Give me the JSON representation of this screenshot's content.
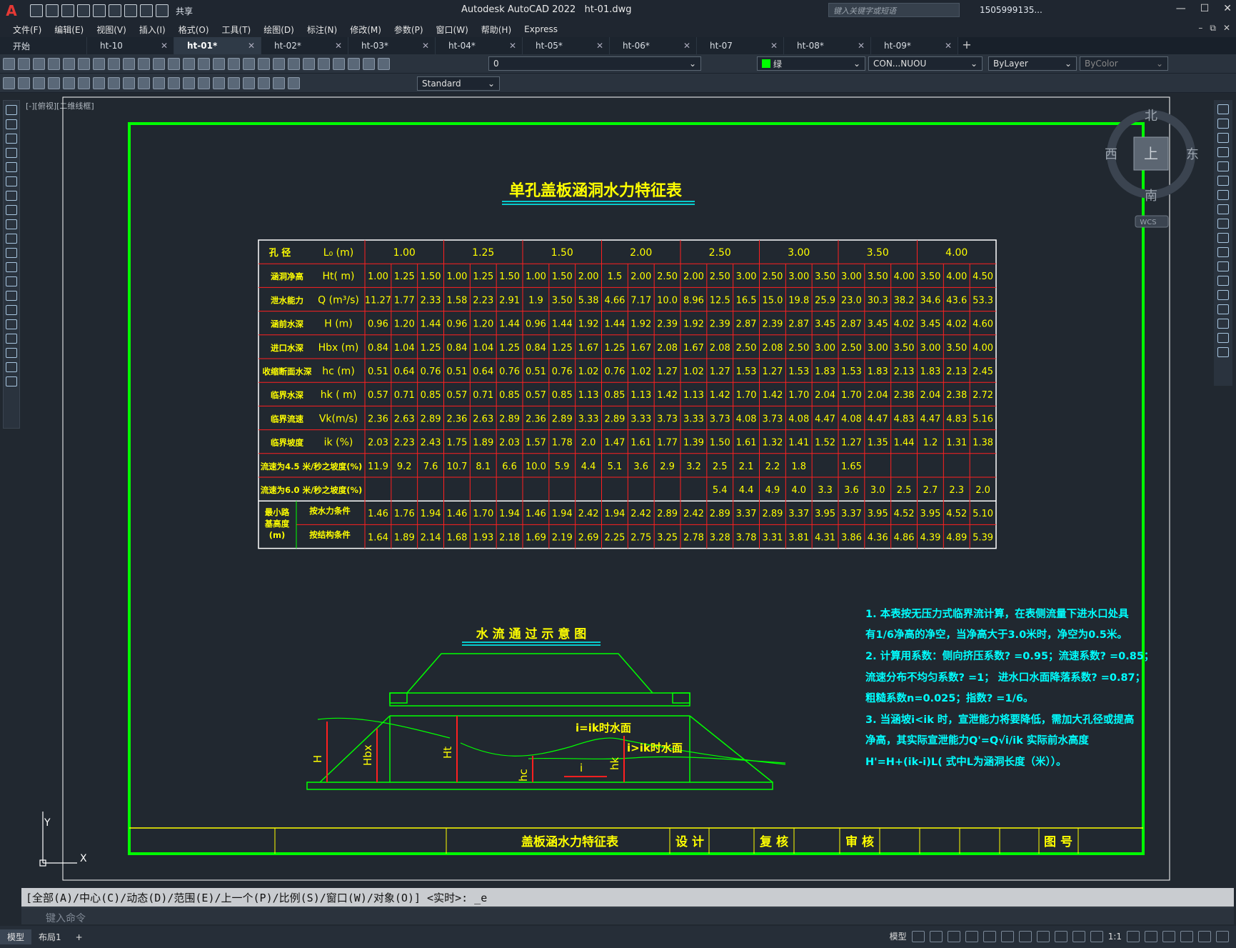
{
  "app": {
    "logo": "A",
    "share": "共享",
    "title": "Autodesk AutoCAD 2022",
    "file": "ht-01.dwg",
    "search_placeholder": "键入关键字或短语",
    "user": "1505999135...",
    "help": "?"
  },
  "menu": [
    "文件(F)",
    "编辑(E)",
    "视图(V)",
    "插入(I)",
    "格式(O)",
    "工具(T)",
    "绘图(D)",
    "标注(N)",
    "修改(M)",
    "参数(P)",
    "窗口(W)",
    "帮助(H)",
    "Express"
  ],
  "tabs": [
    {
      "label": "开始"
    },
    {
      "label": "ht-10"
    },
    {
      "label": "ht-01*",
      "active": true
    },
    {
      "label": "ht-02*"
    },
    {
      "label": "ht-03*"
    },
    {
      "label": "ht-04*"
    },
    {
      "label": "ht-05*"
    },
    {
      "label": "ht-06*"
    },
    {
      "label": "ht-07"
    },
    {
      "label": "ht-08*"
    },
    {
      "label": "ht-09*"
    }
  ],
  "toolbar": {
    "layer": "0",
    "color": "绿",
    "linetype": "CON...NUOU",
    "lineweight": "ByLayer",
    "plotstyle": "ByColor",
    "textstyle": "Standard"
  },
  "viewport": {
    "label": "[-][俯视][二维线框]",
    "compass": {
      "n": "北",
      "s": "南",
      "e": "东",
      "w": "西",
      "top": "上",
      "wcs": "WCS"
    },
    "ucs": {
      "x": "X",
      "y": "Y"
    }
  },
  "drawing": {
    "title": "单孔盖板涵洞水力特征表",
    "table": {
      "header_label": "孔    径",
      "header_unit": "L₀ (m)",
      "spans": [
        "1.00",
        "1.25",
        "1.50",
        "2.00",
        "2.50",
        "3.00",
        "3.50",
        "4.00"
      ],
      "rows": [
        {
          "label": "涵洞净高",
          "unit": "Ht( m)",
          "values": [
            "1.00",
            "1.25",
            "1.50",
            "1.00",
            "1.25",
            "1.50",
            "1.00",
            "1.50",
            "2.00",
            "1.5",
            "2.00",
            "2.50",
            "2.00",
            "2.50",
            "3.00",
            "2.50",
            "3.00",
            "3.50",
            "3.00",
            "3.50",
            "4.00",
            "3.50",
            "4.00",
            "4.50"
          ]
        },
        {
          "label": "泄水能力",
          "unit": "Q (m³/s)",
          "values": [
            "11.27",
            "1.77",
            "2.33",
            "1.58",
            "2.23",
            "2.91",
            "1.9",
            "3.50",
            "5.38",
            "4.66",
            "7.17",
            "10.0",
            "8.96",
            "12.5",
            "16.5",
            "15.0",
            "19.8",
            "25.9",
            "23.0",
            "30.3",
            "38.2",
            "34.6",
            "43.6",
            "53.3"
          ]
        },
        {
          "label": "涵前水深",
          "unit": "H (m)",
          "values": [
            "0.96",
            "1.20",
            "1.44",
            "0.96",
            "1.20",
            "1.44",
            "0.96",
            "1.44",
            "1.92",
            "1.44",
            "1.92",
            "2.39",
            "1.92",
            "2.39",
            "2.87",
            "2.39",
            "2.87",
            "3.45",
            "2.87",
            "3.45",
            "4.02",
            "3.45",
            "4.02",
            "4.60"
          ]
        },
        {
          "label": "进口水深",
          "unit": "Hbx (m)",
          "values": [
            "0.84",
            "1.04",
            "1.25",
            "0.84",
            "1.04",
            "1.25",
            "0.84",
            "1.25",
            "1.67",
            "1.25",
            "1.67",
            "2.08",
            "1.67",
            "2.08",
            "2.50",
            "2.08",
            "2.50",
            "3.00",
            "2.50",
            "3.00",
            "3.50",
            "3.00",
            "3.50",
            "4.00"
          ]
        },
        {
          "label": "收缩断面水深",
          "unit": "hc (m)",
          "values": [
            "0.51",
            "0.64",
            "0.76",
            "0.51",
            "0.64",
            "0.76",
            "0.51",
            "0.76",
            "1.02",
            "0.76",
            "1.02",
            "1.27",
            "1.02",
            "1.27",
            "1.53",
            "1.27",
            "1.53",
            "1.83",
            "1.53",
            "1.83",
            "2.13",
            "1.83",
            "2.13",
            "2.45"
          ]
        },
        {
          "label": "临界水深",
          "unit": "hk ( m)",
          "values": [
            "0.57",
            "0.71",
            "0.85",
            "0.57",
            "0.71",
            "0.85",
            "0.57",
            "0.85",
            "1.13",
            "0.85",
            "1.13",
            "1.42",
            "1.13",
            "1.42",
            "1.70",
            "1.42",
            "1.70",
            "2.04",
            "1.70",
            "2.04",
            "2.38",
            "2.04",
            "2.38",
            "2.72"
          ]
        },
        {
          "label": "临界流速",
          "unit": "Vk(m/s)",
          "values": [
            "2.36",
            "2.63",
            "2.89",
            "2.36",
            "2.63",
            "2.89",
            "2.36",
            "2.89",
            "3.33",
            "2.89",
            "3.33",
            "3.73",
            "3.33",
            "3.73",
            "4.08",
            "3.73",
            "4.08",
            "4.47",
            "4.08",
            "4.47",
            "4.83",
            "4.47",
            "4.83",
            "5.16"
          ]
        },
        {
          "label": "临界坡度",
          "unit": "ik (%)",
          "values": [
            "2.03",
            "2.23",
            "2.43",
            "1.75",
            "1.89",
            "2.03",
            "1.57",
            "1.78",
            "2.0",
            "1.47",
            "1.61",
            "1.77",
            "1.39",
            "1.50",
            "1.61",
            "1.32",
            "1.41",
            "1.52",
            "1.27",
            "1.35",
            "1.44",
            "1.2",
            "1.31",
            "1.38"
          ]
        },
        {
          "label": "流速为4.5 米/秒之坡度(%)",
          "unit": "",
          "values": [
            "11.9",
            "9.2",
            "7.6",
            "10.7",
            "8.1",
            "6.6",
            "10.0",
            "5.9",
            "4.4",
            "5.1",
            "3.6",
            "2.9",
            "3.2",
            "2.5",
            "2.1",
            "2.2",
            "1.8",
            "",
            "1.65",
            "",
            "",
            "",
            "",
            ""
          ]
        },
        {
          "label": "流速为6.0 米/秒之坡度(%)",
          "unit": "",
          "values": [
            "",
            "",
            "",
            "",
            "",
            "",
            "",
            "",
            "",
            "",
            "",
            "",
            "",
            "5.4",
            "4.4",
            "4.9",
            "4.0",
            "3.3",
            "3.6",
            "3.0",
            "2.5",
            "2.7",
            "2.3",
            "2.0"
          ]
        }
      ],
      "min_group_label": [
        "最小路",
        "基高度",
        "(m)"
      ],
      "min_rows": [
        {
          "label": "按水力条件",
          "values": [
            "1.46",
            "1.76",
            "1.94",
            "1.46",
            "1.70",
            "1.94",
            "1.46",
            "1.94",
            "2.42",
            "1.94",
            "2.42",
            "2.89",
            "2.42",
            "2.89",
            "3.37",
            "2.89",
            "3.37",
            "3.95",
            "3.37",
            "3.95",
            "4.52",
            "3.95",
            "4.52",
            "5.10"
          ]
        },
        {
          "label": "按结构条件",
          "values": [
            "1.64",
            "1.89",
            "2.14",
            "1.68",
            "1.93",
            "2.18",
            "1.69",
            "2.19",
            "2.69",
            "2.25",
            "2.75",
            "3.25",
            "2.78",
            "3.28",
            "3.78",
            "3.31",
            "3.81",
            "4.31",
            "3.86",
            "4.36",
            "4.86",
            "4.39",
            "4.89",
            "5.39"
          ]
        }
      ]
    },
    "diagram": {
      "title": "水 流 通 过 示 意 图",
      "labels": {
        "H": "H",
        "Hbx": "Hbx",
        "Ht": "Ht",
        "hc": "hc",
        "hk": "hk",
        "i": "i",
        "ik_surface": "i=ik时水面",
        "gt_surface": "i>ik时水面"
      }
    },
    "notes": [
      "1.  本表按无压力式临界流计算，在表侧流量下进水口处具",
      "     有1/6净高的净空，当净高大于3.0米时，净空为0.5米。",
      "2.  计算用系数：侧向挤压系数? =0.95；流速系数? =0.85；",
      "     流速分布不均匀系数? =1；  进水口水面降落系数? =0.87；",
      "     粗糙系数n=0.025；指数? =1/6。",
      "3.  当涵坡i<ik 时，宣泄能力将要降低，需加大孔径或提高",
      "    净高，其实际宣泄能力Q'=Q√i/ik  实际前水高度",
      "    H'=H+(ik-i)L(  式中L为涵洞长度（米））。"
    ],
    "titleblock": {
      "name": "盖板涵水力特征表",
      "design": "设  计",
      "check": "复 核",
      "review": "审 核",
      "drawing_no": "图 号"
    }
  },
  "command": {
    "history": "[全部(A)/中心(C)/动态(D)/范围(E)/上一个(P)/比例(S)/窗口(W)/对象(O)] <实时>: _e",
    "placeholder": "键入命令"
  },
  "status": {
    "model": "模型",
    "layout1": "布局1",
    "add": "+",
    "model_right": "模型",
    "scale": "1:1"
  }
}
